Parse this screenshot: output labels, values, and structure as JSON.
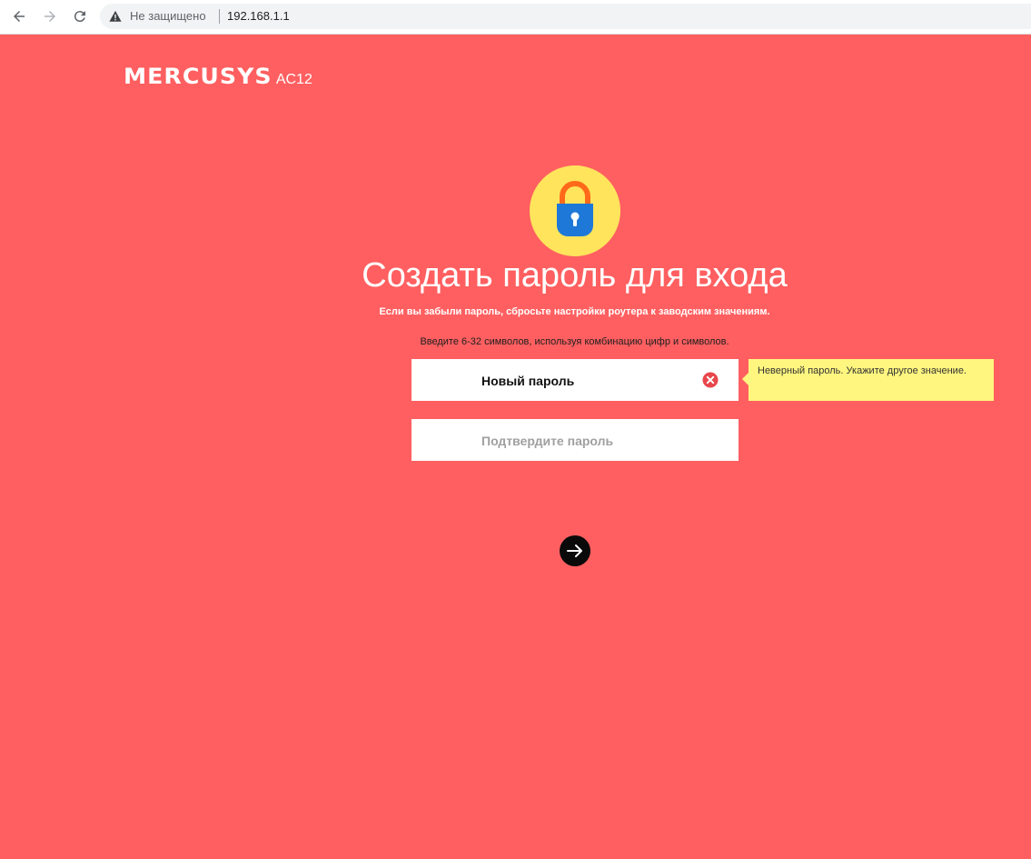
{
  "browser": {
    "security_label": "Не защищено",
    "url": "192.168.1.1",
    "icons": [
      "back-arrow-icon",
      "forward-arrow-icon",
      "reload-icon",
      "warning-icon"
    ]
  },
  "brand": {
    "logo": "MERCUSYS",
    "model": "AC12"
  },
  "page": {
    "title": "Создать пароль для входа",
    "reset_note": "Если вы забыли пароль, сбросьте настройки роутера к заводским значениям.",
    "hint": "Введите 6-32 символов, используя комбинацию цифр и символов."
  },
  "form": {
    "new_password_label": "Новый пароль",
    "confirm_password_label": "Подтвердите пароль",
    "error_tooltip": "Неверный пароль. Укажите другое значение.",
    "next_icon": "arrow-right-icon"
  },
  "colors": {
    "background": "#ff5f60",
    "lock_circle": "#ffe45c",
    "tooltip": "#fff67f",
    "error": "#e8474c"
  }
}
